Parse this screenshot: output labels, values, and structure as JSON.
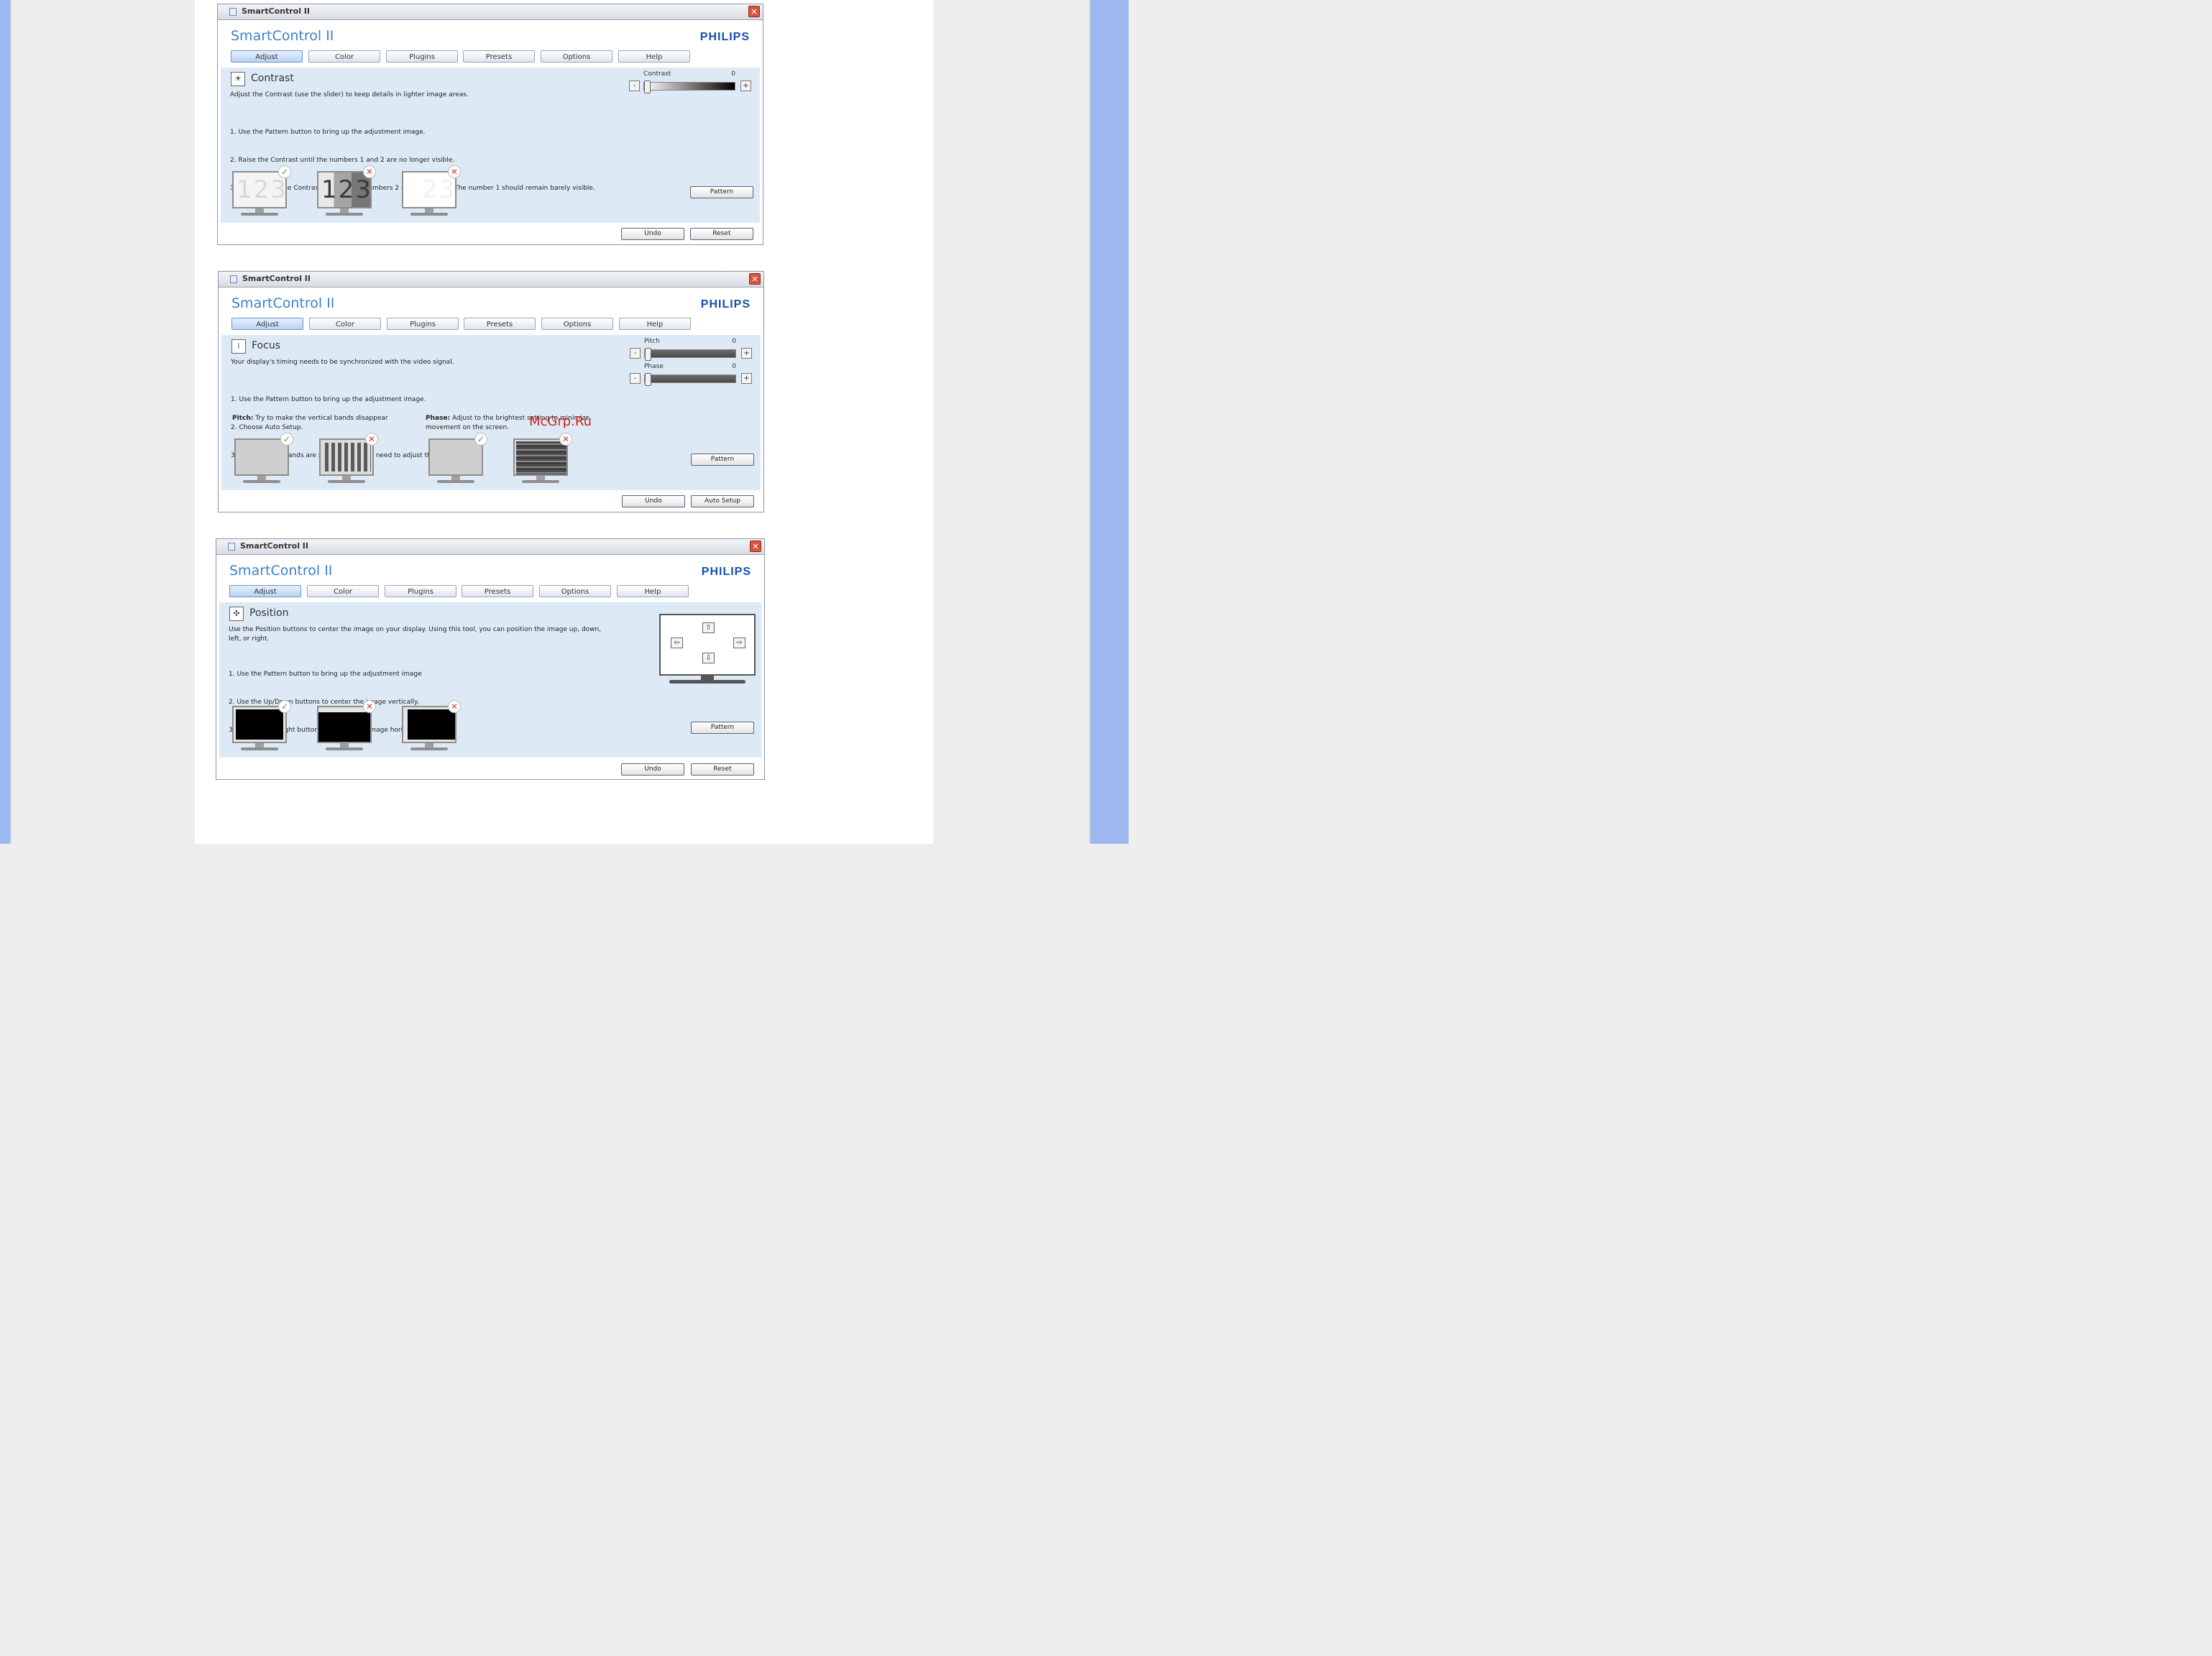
{
  "window_title": "SmartControl II",
  "app_title": "SmartControl II",
  "brand": "PHILIPS",
  "tabs": [
    "Adjust",
    "Color",
    "Plugins",
    "Presets",
    "Options",
    "Help"
  ],
  "marks": {
    "ok": "✓",
    "bad": "✕"
  },
  "windows": {
    "contrast": {
      "section_title": "Contrast",
      "description": "Adjust the Contrast (use the slider) to keep details in lighter image areas.",
      "steps": [
        "1. Use the Pattern button to bring up the adjustment image.",
        "2. Raise the Contrast until the numbers 1 and 2 are no longer visible.",
        "3. Slowly lower the Contrast to make the numbers 2 and 3 reappear. The number 1 should remain barely visible."
      ],
      "slider": {
        "label": "Contrast",
        "value": "0",
        "minus": "-",
        "plus": "+"
      },
      "previews": [
        {
          "digits": "123",
          "status": "ok"
        },
        {
          "digits": "123",
          "status": "bad"
        },
        {
          "digits": "23",
          "status": "bad"
        }
      ],
      "pattern_button": "Pattern",
      "undo_button": "Undo",
      "reset_button": "Reset"
    },
    "focus": {
      "section_title": "Focus",
      "description": "Your display's timing needs to be synchronized with the video signal.",
      "steps": [
        "1. Use the Pattern button to bring up the adjustment image.",
        "2. Choose Auto Setup.",
        "3. If the vertical bands are still visible, you'll need to adjust the Pitch."
      ],
      "pitch_slider": {
        "label": "Pitch",
        "value": "0",
        "minus": "-",
        "plus": "+"
      },
      "phase_slider": {
        "label": "Phase",
        "value": "0",
        "minus": "-",
        "plus": "+"
      },
      "pitch_note_label": "Pitch:",
      "pitch_note": "Try to make the vertical bands disappear",
      "phase_note_label": "Phase:",
      "phase_note": "Adjust to the brightest setting to minimize\nmovement on the screen.",
      "pattern_button": "Pattern",
      "undo_button": "Undo",
      "auto_setup_button": "Auto Setup"
    },
    "position": {
      "section_title": "Position",
      "description": "Use the Position buttons to center the image on your display. Using this tool, you can position the image up, down,\nleft, or right.",
      "steps": [
        "1. Use the Pattern button to bring up the adjustment image",
        "2. Use the Up/Down buttons to center the image vertically.",
        "3. Use the Left/Right buttons to center the image horizontally."
      ],
      "arrows": {
        "up": "⇧",
        "down": "⇩",
        "left": "⇦",
        "right": "⇨"
      },
      "pattern_button": "Pattern",
      "undo_button": "Undo",
      "reset_button": "Reset"
    }
  },
  "watermark": "McGrp.Ru"
}
